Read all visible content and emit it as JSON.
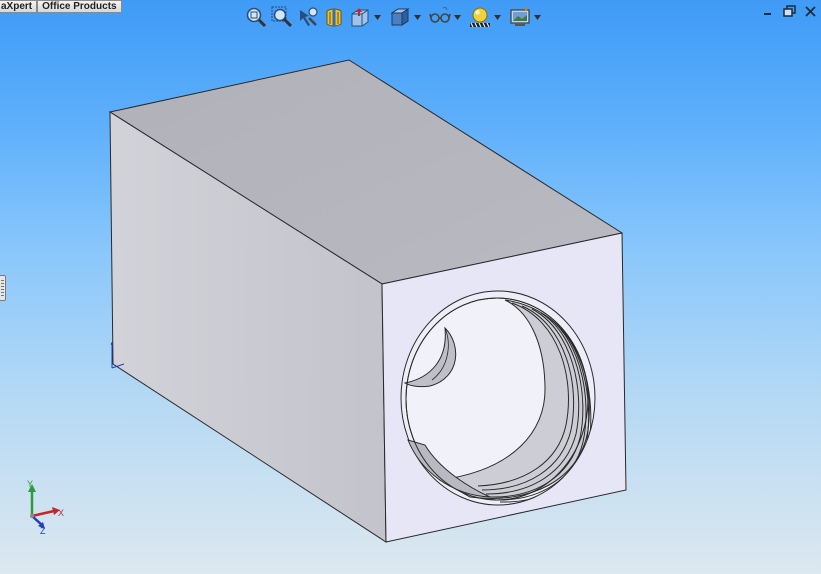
{
  "tabs": [
    {
      "label": "aXpert"
    },
    {
      "label": "Office Products"
    }
  ],
  "toolbar": {
    "buttons": [
      {
        "id": "zoom-to-fit",
        "icon": "zoom-to-fit-icon"
      },
      {
        "id": "zoom-to-area",
        "icon": "zoom-to-area-icon"
      },
      {
        "id": "previous-view",
        "icon": "previous-view-icon"
      },
      {
        "id": "section-view",
        "icon": "section-view-icon"
      },
      {
        "id": "view-orientation",
        "icon": "view-orientation-icon",
        "dropdown": true
      },
      {
        "id": "display-style",
        "icon": "display-style-icon",
        "dropdown": true
      },
      {
        "id": "hide-show-items",
        "icon": "hide-show-items-icon",
        "dropdown": true
      },
      {
        "id": "edit-appearance",
        "icon": "edit-appearance-icon",
        "dropdown": true
      },
      {
        "id": "apply-scene",
        "icon": "apply-scene-icon",
        "dropdown": true
      }
    ]
  },
  "window_controls": [
    "minimize-icon",
    "restore-icon",
    "close-icon"
  ],
  "triad": {
    "x_label": "X",
    "y_label": "Y",
    "z_label": "Z",
    "x_color": "#c0282e",
    "y_color": "#2e9a3a",
    "z_color": "#2340b8"
  },
  "colors": {
    "background_top": "#3f9bf6",
    "background_bottom": "#dde8ef",
    "part_face": "#b4b4bc",
    "front_face": "#e6e6f6"
  }
}
